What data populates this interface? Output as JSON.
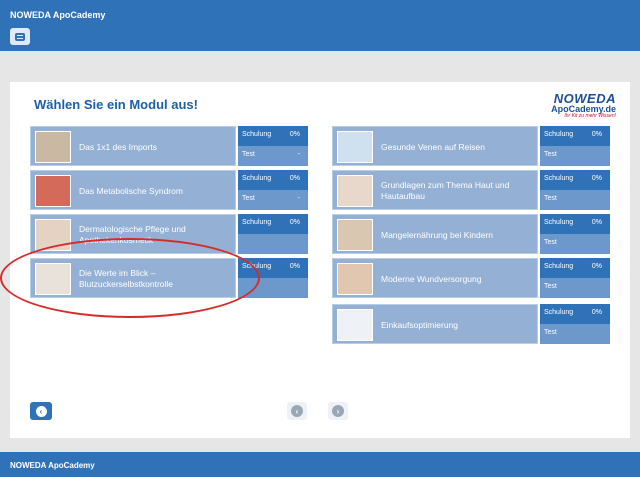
{
  "app": {
    "title": "NOWEDA ApoCademy"
  },
  "page": {
    "heading": "Wählen Sie ein Modul aus!"
  },
  "logo": {
    "line1": "NOWEDA",
    "line2": "ApoCademy.de",
    "line3": "Ihr Kit zu mehr Wissen!"
  },
  "left_modules": [
    {
      "label": "Das 1x1 des Imports",
      "schulung": "Schulung",
      "schulung_pct": "0%",
      "test": "Test",
      "test_val": "-"
    },
    {
      "label": "Das Metabolische Syndrom",
      "schulung": "Schulung",
      "schulung_pct": "0%",
      "test": "Test",
      "test_val": "-"
    },
    {
      "label": "Dermatologische Pflege und Apothekenkosmetik",
      "schulung": "Schulung",
      "schulung_pct": "0%",
      "test": "",
      "test_val": ""
    },
    {
      "label": "Die Werte im Blick – Blutzuckerselbstkontrolle",
      "schulung": "Schulung",
      "schulung_pct": "0%",
      "test": "",
      "test_val": ""
    }
  ],
  "right_modules": [
    {
      "label": "Gesunde Venen auf Reisen",
      "schulung": "Schulung",
      "schulung_pct": "0%",
      "test": "Test"
    },
    {
      "label": "Grundlagen zum Thema Haut und Hautaufbau",
      "schulung": "Schulung",
      "schulung_pct": "0%",
      "test": "Test"
    },
    {
      "label": "Mangelernährung bei Kindern",
      "schulung": "Schulung",
      "schulung_pct": "0%",
      "test": "Test"
    },
    {
      "label": "Moderne Wundversorgung",
      "schulung": "Schulung",
      "schulung_pct": "0%",
      "test": "Test"
    },
    {
      "label": "Einkaufsoptimierung",
      "schulung": "Schulung",
      "schulung_pct": "0%",
      "test": "Test"
    }
  ],
  "nav": {
    "back_glyph": "‹",
    "prev_glyph": "‹",
    "next_glyph": "›"
  },
  "icons": {
    "menu": "menu-icon",
    "back": "chevron-left-icon",
    "prev": "chevron-left-icon",
    "next": "chevron-right-icon"
  },
  "colors": {
    "brand_blue": "#2f72b8",
    "tile": "#94b0d4",
    "highlight": "#d62b2b"
  }
}
